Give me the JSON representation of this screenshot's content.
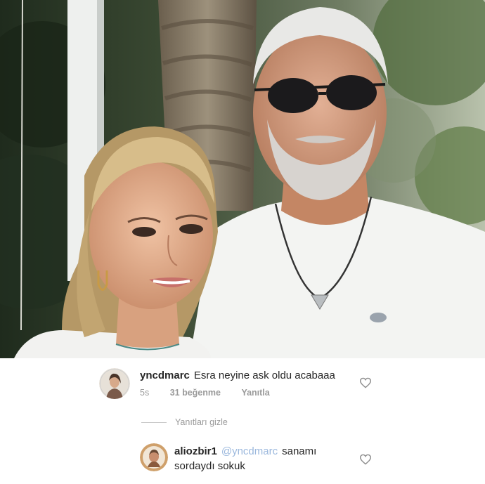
{
  "comment1": {
    "username": "yncdmarc",
    "text": "Esra neyine ask oldu acabaaa",
    "time": "5s",
    "likes": "31 beğenme",
    "reply_label": "Yanıtla"
  },
  "hide_replies_label": "Yanıtları gizle",
  "comment2": {
    "username": "aliozbir1",
    "mention": "@yncdmarc",
    "text_line1": "sanamı",
    "text_line2": "sordaydı sokuk"
  },
  "icons": {
    "like": "heart-outline-icon",
    "avatar1": "profile-avatar",
    "avatar2": "profile-avatar"
  },
  "colors": {
    "text": "#262626",
    "meta": "#9a9a9a",
    "mention": "#9bb8dd"
  }
}
